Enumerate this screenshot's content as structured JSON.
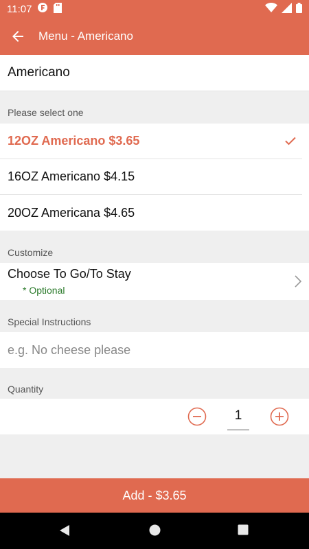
{
  "status_bar": {
    "time": "11:07"
  },
  "app_bar": {
    "title": "Menu - Americano"
  },
  "item": {
    "name": "Americano"
  },
  "size_section": {
    "label": "Please select one",
    "options": [
      {
        "label": "12OZ Americano $3.65",
        "selected": true
      },
      {
        "label": "16OZ Americano $4.15",
        "selected": false
      },
      {
        "label": "20OZ Americana $4.65",
        "selected": false
      }
    ]
  },
  "customize_section": {
    "label": "Customize",
    "option_label": "Choose To Go/To Stay",
    "optional_note": "* Optional"
  },
  "instructions_section": {
    "label": "Special Instructions",
    "placeholder": "e.g. No cheese please",
    "value": ""
  },
  "quantity_section": {
    "label": "Quantity",
    "value": "1"
  },
  "add_button": {
    "label": "Add - $3.65"
  },
  "colors": {
    "accent": "#e06a50",
    "optional_green": "#2a7a2a"
  }
}
